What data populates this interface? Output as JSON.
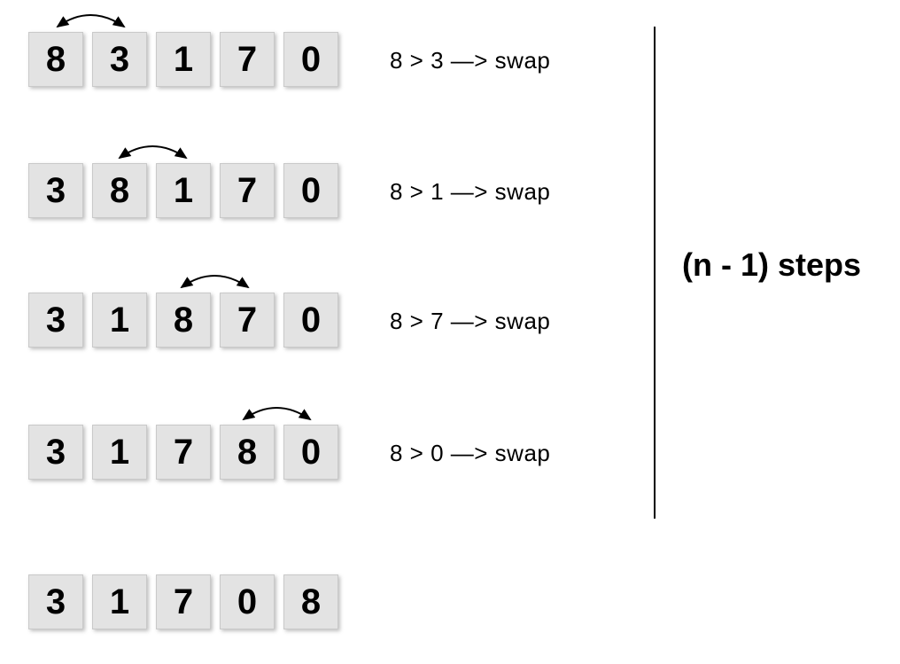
{
  "rows": [
    {
      "values": [
        "8",
        "3",
        "1",
        "7",
        "0"
      ],
      "annotation": "8 > 3 —>  swap",
      "swap_between": [
        0,
        1
      ]
    },
    {
      "values": [
        "3",
        "8",
        "1",
        "7",
        "0"
      ],
      "annotation": "8 > 1 —>  swap",
      "swap_between": [
        1,
        2
      ]
    },
    {
      "values": [
        "3",
        "1",
        "8",
        "7",
        "0"
      ],
      "annotation": "8 > 7 —>  swap",
      "swap_between": [
        2,
        3
      ]
    },
    {
      "values": [
        "3",
        "1",
        "7",
        "8",
        "0"
      ],
      "annotation": "8 > 0 —>  swap",
      "swap_between": [
        3,
        4
      ]
    },
    {
      "values": [
        "3",
        "1",
        "7",
        "0",
        "8"
      ],
      "annotation": null,
      "swap_between": null
    }
  ],
  "steps_label": "(n - 1) steps"
}
